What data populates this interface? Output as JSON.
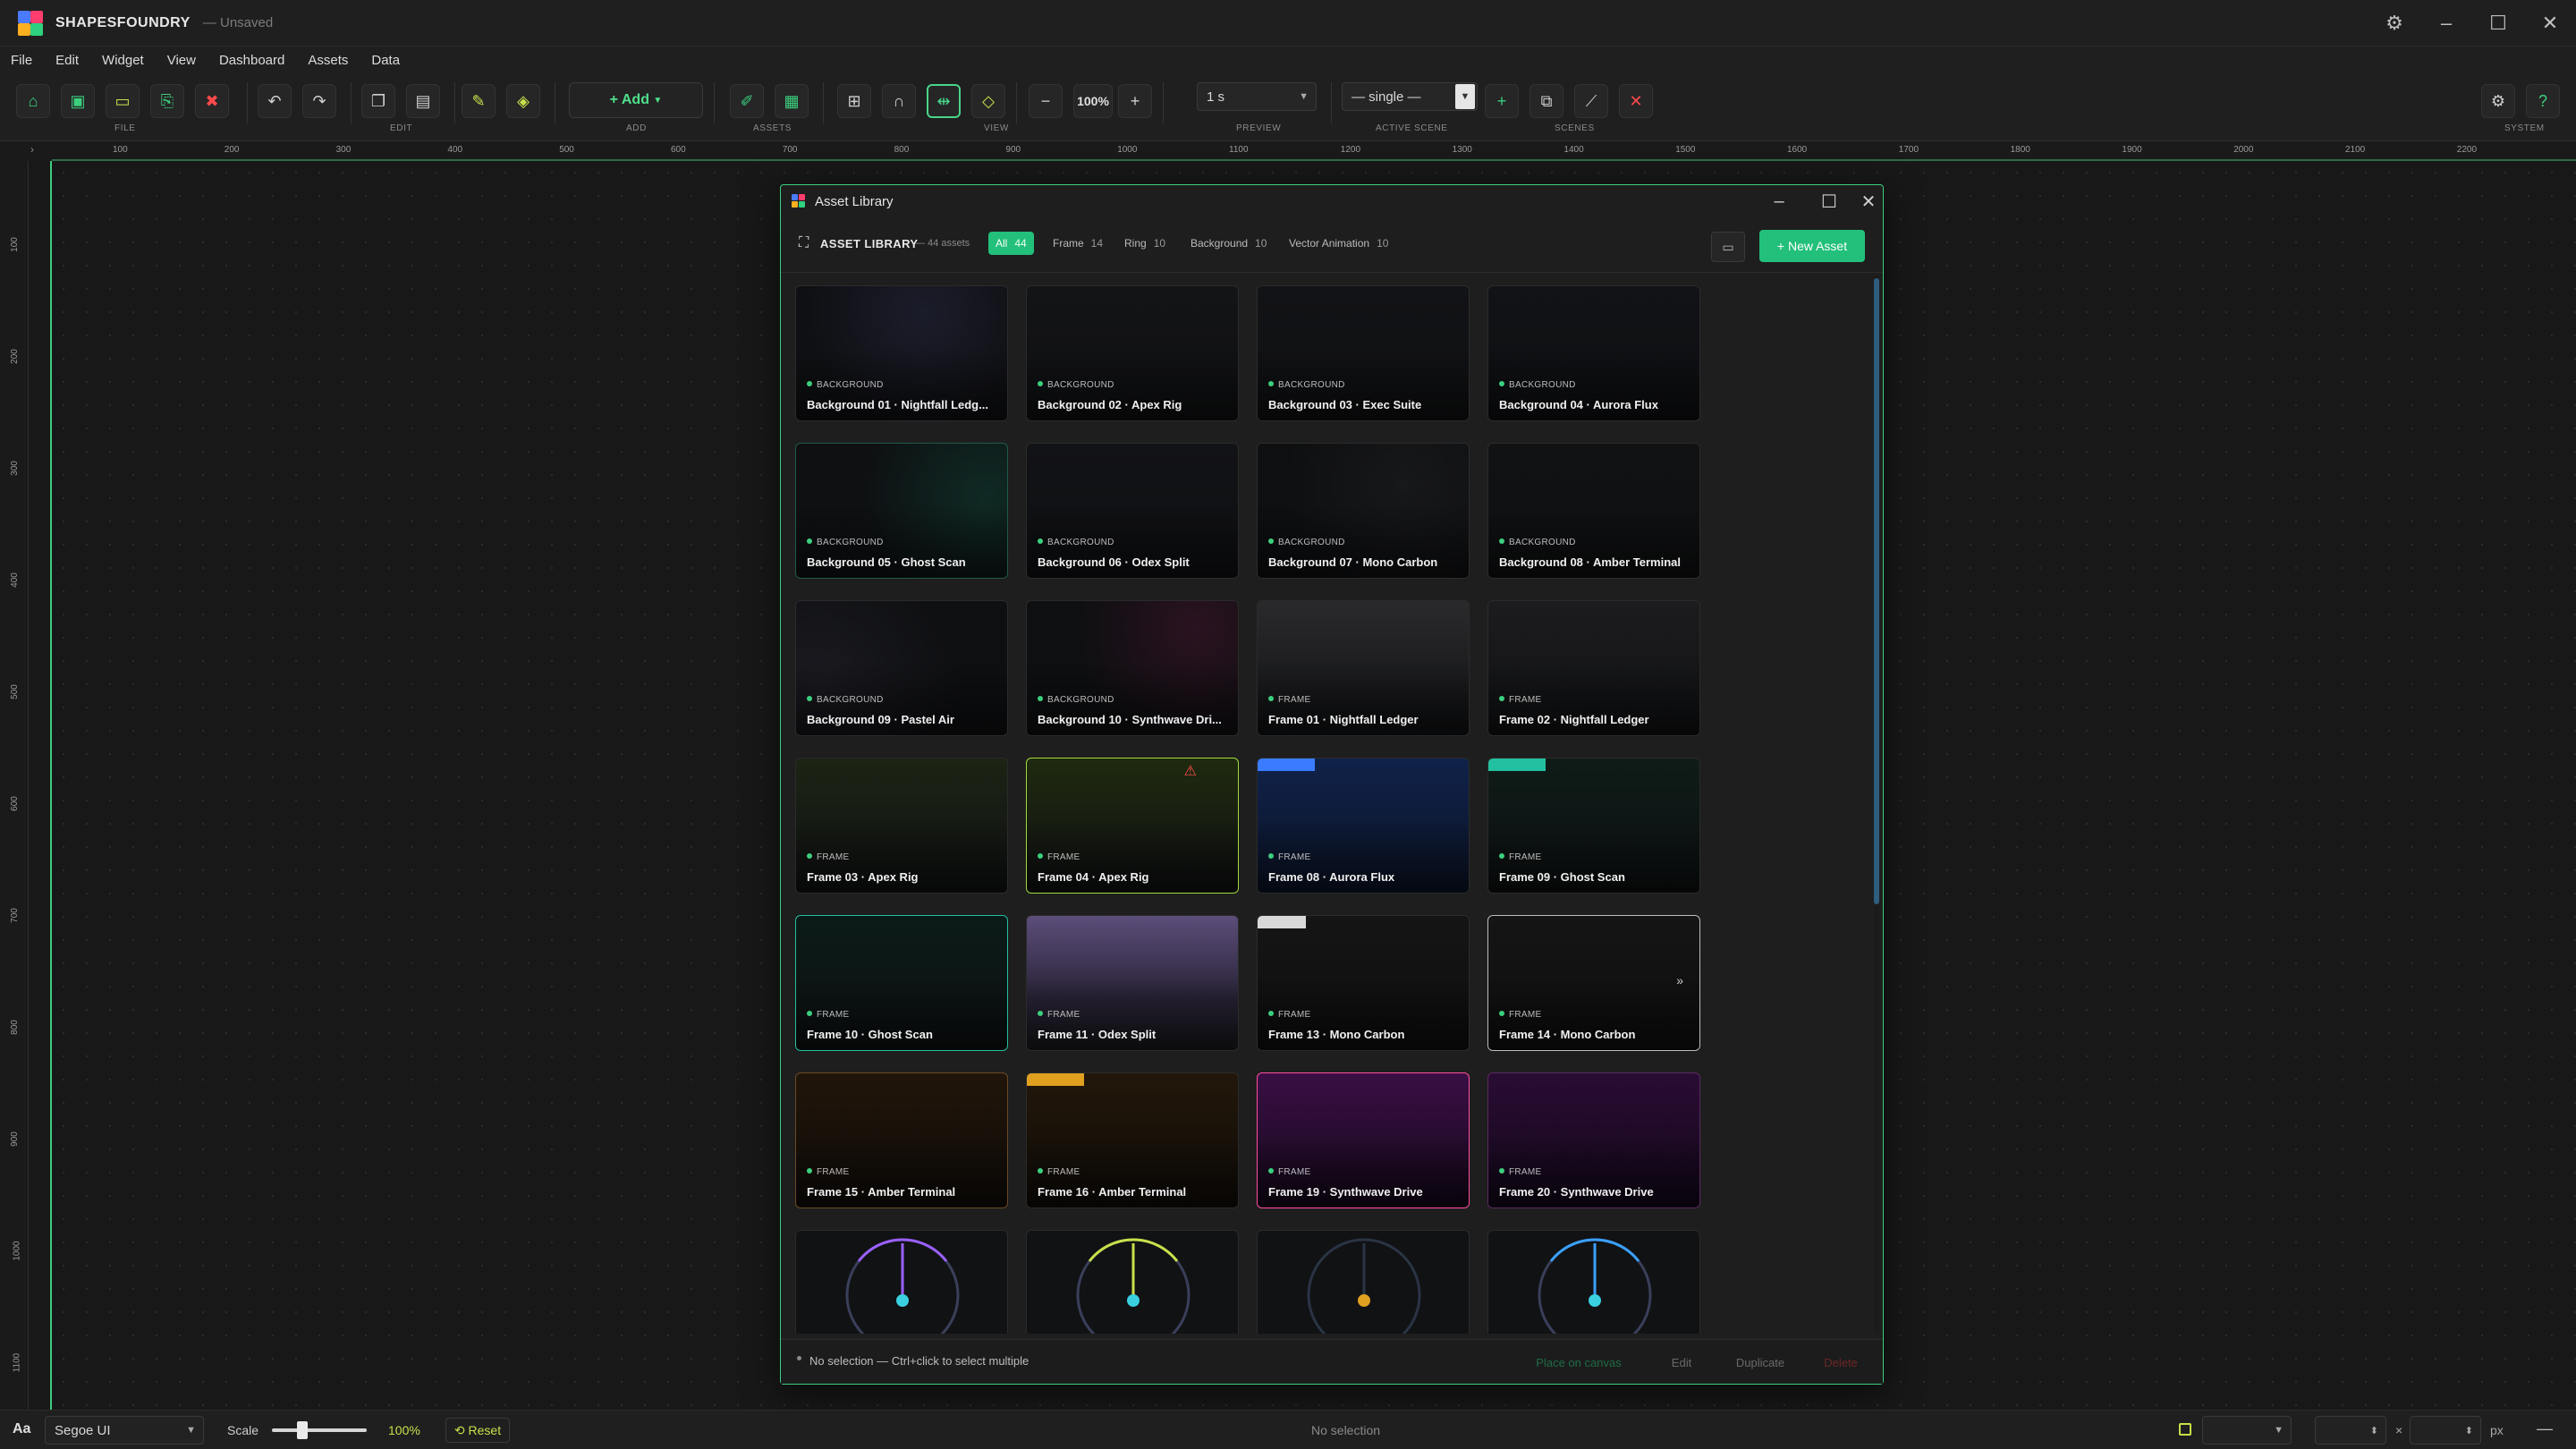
{
  "app": {
    "name": "SHAPESFOUNDRY",
    "doc_state": "— Unsaved"
  },
  "menu": [
    "File",
    "Edit",
    "Widget",
    "View",
    "Dashboard",
    "Assets",
    "Data"
  ],
  "toolbar": {
    "groups": [
      "FILE",
      "EDIT",
      "ADD",
      "ASSETS",
      "VIEW",
      "PREVIEW",
      "ACTIVE SCENE",
      "SCENES",
      "SYSTEM"
    ],
    "add_label": "+ Add",
    "zoom": "100%",
    "preview_duration": "1 s",
    "active_scene": "— single —"
  },
  "ruler": {
    "x_ticks": [
      "100",
      "200",
      "300",
      "400",
      "500",
      "600",
      "700",
      "800",
      "900",
      "1000",
      "1100",
      "1200",
      "1300",
      "1400",
      "1500",
      "1600",
      "1700",
      "1800",
      "1900",
      "2000",
      "2100",
      "2200"
    ],
    "y_ticks": [
      "100",
      "200",
      "300",
      "400",
      "500",
      "600",
      "700",
      "800",
      "900",
      "1000",
      "1100"
    ]
  },
  "dialog": {
    "title": "Asset Library",
    "library_label": "ASSET LIBRARY",
    "count_label": "— 44 assets",
    "filters": [
      {
        "label": "All",
        "count": "44",
        "active": true
      },
      {
        "label": "Frame",
        "count": "14"
      },
      {
        "label": "Ring",
        "count": "10"
      },
      {
        "label": "Background",
        "count": "10"
      },
      {
        "label": "Vector Animation",
        "count": "10"
      }
    ],
    "new_asset": "+ New Asset",
    "assets": [
      {
        "cat": "BACKGROUND",
        "name": "Background 01 · Nightfall Ledg..."
      },
      {
        "cat": "BACKGROUND",
        "name": "Background 02 · Apex Rig"
      },
      {
        "cat": "BACKGROUND",
        "name": "Background 03 · Exec Suite"
      },
      {
        "cat": "BACKGROUND",
        "name": "Background 04 · Aurora Flux"
      },
      {
        "cat": "BACKGROUND",
        "name": "Background 05 · Ghost Scan"
      },
      {
        "cat": "BACKGROUND",
        "name": "Background 06 · Odex Split"
      },
      {
        "cat": "BACKGROUND",
        "name": "Background 07 · Mono Carbon"
      },
      {
        "cat": "BACKGROUND",
        "name": "Background 08 · Amber Terminal"
      },
      {
        "cat": "BACKGROUND",
        "name": "Background 09 · Pastel Air"
      },
      {
        "cat": "BACKGROUND",
        "name": "Background 10 · Synthwave Dri..."
      },
      {
        "cat": "FRAME",
        "name": "Frame 01 · Nightfall Ledger"
      },
      {
        "cat": "FRAME",
        "name": "Frame 02 · Nightfall Ledger"
      },
      {
        "cat": "FRAME",
        "name": "Frame 03 · Apex Rig"
      },
      {
        "cat": "FRAME",
        "name": "Frame 04 · Apex Rig"
      },
      {
        "cat": "FRAME",
        "name": "Frame 08 · Aurora Flux"
      },
      {
        "cat": "FRAME",
        "name": "Frame 09 · Ghost Scan"
      },
      {
        "cat": "FRAME",
        "name": "Frame 10 · Ghost Scan"
      },
      {
        "cat": "FRAME",
        "name": "Frame 11 · Odex Split"
      },
      {
        "cat": "FRAME",
        "name": "Frame 13 · Mono Carbon"
      },
      {
        "cat": "FRAME",
        "name": "Frame 14 · Mono Carbon"
      },
      {
        "cat": "FRAME",
        "name": "Frame 15 · Amber Terminal"
      },
      {
        "cat": "FRAME",
        "name": "Frame 16 · Amber Terminal"
      },
      {
        "cat": "FRAME",
        "name": "Frame 19 · Synthwave Drive"
      },
      {
        "cat": "FRAME",
        "name": "Frame 20 · Synthwave Drive"
      }
    ],
    "footer": {
      "status": "No selection — Ctrl+click to select multiple",
      "place": "Place on canvas",
      "edit": "Edit",
      "duplicate": "Duplicate",
      "delete": "Delete"
    }
  },
  "status": {
    "font_icon": "Aa",
    "font": "Segoe UI",
    "scale_label": "Scale",
    "scale_value": "100%",
    "reset": "⟲ Reset",
    "selection": "No selection",
    "size_sep": "×",
    "unit": "px"
  },
  "colors": {
    "accent": "#22c07a",
    "danger": "#ff4a4a",
    "tool_yellow": "#c9e04a"
  }
}
